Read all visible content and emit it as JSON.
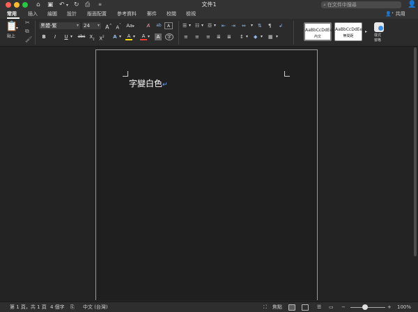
{
  "window": {
    "title": "文件1",
    "search_placeholder": "在文件中搜尋",
    "share_label": "共用"
  },
  "tabs": [
    {
      "label": "常用",
      "active": true
    },
    {
      "label": "插入"
    },
    {
      "label": "繪圖"
    },
    {
      "label": "設計"
    },
    {
      "label": "版面配置"
    },
    {
      "label": "參考資料"
    },
    {
      "label": "郵件"
    },
    {
      "label": "校閱"
    },
    {
      "label": "檢視"
    }
  ],
  "ribbon": {
    "paste_label": "貼上",
    "font_name": "黑體-繁",
    "font_size": "24",
    "grow_font": "A",
    "shrink_font": "A",
    "aa_label": "Aa",
    "bold": "B",
    "italic": "I",
    "underline": "U",
    "strikethrough": "abc",
    "subscript": "X",
    "superscript": "X",
    "text_effects": "A",
    "highlight": "A",
    "font_color": "A",
    "char_shading": "A",
    "phonetic": "字",
    "styles": [
      {
        "sample": "AaBbCcDdEe",
        "name": "內文",
        "selected": true
      },
      {
        "sample": "AaBbCcDdEe",
        "name": "無間距"
      }
    ],
    "styles_pane_label": "樣式\n窗格"
  },
  "document": {
    "text": "字變白色",
    "paragraph_mark": "↵"
  },
  "status": {
    "page": "第 1 頁，共 1 頁",
    "words": "4 個字",
    "language": "中文 (台灣)",
    "focus": "焦點",
    "zoom": "100%"
  },
  "colors": {
    "highlight": "#ffde00",
    "font_color": "#ff3b30",
    "page_bg": "#1f1f1f"
  }
}
